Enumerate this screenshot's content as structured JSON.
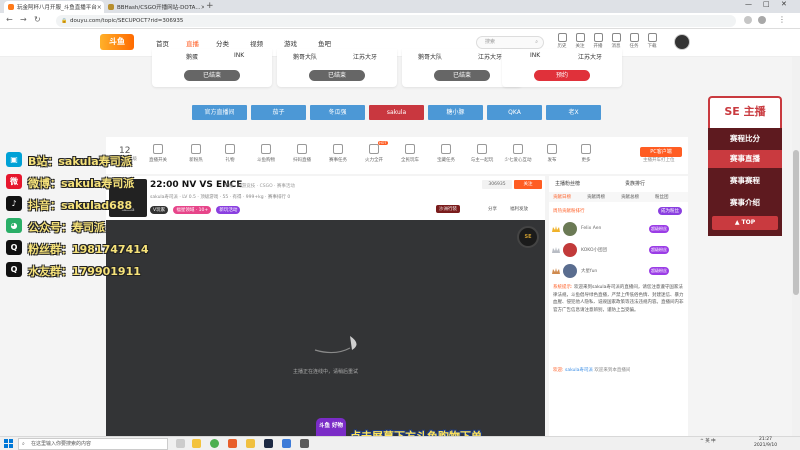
{
  "browser": {
    "tabs": [
      {
        "title": "玩金阿杯八月开服_斗鱼直播平台",
        "active": true
      },
      {
        "title": "BBHash/CSGO开播网站-DOTA...",
        "active": false
      }
    ],
    "new_tab": "+",
    "window_controls": [
      "—",
      "□",
      "✕"
    ],
    "url": "douyu.com/topic/SECUPOCT?rid=306935"
  },
  "site": {
    "logo": "斗鱼",
    "nav": [
      "首页",
      "直播",
      "分类",
      "视频",
      "游戏",
      "鱼吧"
    ],
    "nav_active": "直播",
    "search_placeholder": "搜索",
    "header_icons": [
      "历史",
      "关注",
      "开播",
      "消息",
      "任务",
      "下载"
    ]
  },
  "schedule": [
    {
      "left": "鹅蛋",
      "right": "INK",
      "button": "已结束"
    },
    {
      "left": "鹅哥大队",
      "right": "江苏大牙",
      "button": "已结束"
    },
    {
      "left": "鹅哥大队",
      "right": "江苏大牙",
      "button": "已结束"
    },
    {
      "left": "INK",
      "right": "江苏大牙",
      "button": "预约"
    }
  ],
  "streamer_tabs": [
    "官方直播间",
    "茄子",
    "冬瓜强",
    "sakula",
    "糖小豚",
    "QKA",
    "老X"
  ],
  "streamer_tab_active": "sakula",
  "activity": {
    "fan_count": "12",
    "fan_label": "主播等级",
    "items": [
      "直播开关",
      "新粉热",
      "礼物",
      "斗鱼购物",
      "扫码直播",
      "赛事任务",
      "火力全开",
      "全民玩车",
      "宝藏任务",
      "与主一起玩",
      "少七爱心互动",
      "发布",
      "更多"
    ],
    "pc_button": "PC客户端",
    "pc_sub": "主播开车打上位"
  },
  "room": {
    "anchor_name": "sakula",
    "title": "22:00 NV VS ENCE",
    "category": "单端 · 同游竞技 · CSGO · 赛事活动",
    "meta": "sakula寿司派 · LV 0.5 · 顶级游戏 · 55 · 有得 · 999+kg · 赛事排行 0",
    "tags": [
      "V玩家",
      "福星领域 · 10+",
      "新玩活动"
    ],
    "room_no": "306935",
    "follow": "关注",
    "actions": [
      "分享",
      "福利发放"
    ],
    "report": "沙洲行装",
    "loading_text": "主播正在连线中，请稍后重试"
  },
  "chat": {
    "tabs": [
      "主播粉丝榜",
      "贵族排行"
    ],
    "subtabs": [
      "贡献日榜",
      "贡献周榜",
      "贡献总榜",
      "粉丝团"
    ],
    "week_label": "周热贡献粉排行",
    "week_button": "成为粉丝",
    "ranks": [
      {
        "name": "Felix Aen",
        "badge": "超级粉丝"
      },
      {
        "name": "KOKO小团团",
        "badge": "超级粉丝"
      },
      {
        "name": "大星fun",
        "badge": "超级粉丝"
      }
    ],
    "system_label": "系统提示:",
    "system_msg": "欢迎来到sakula寿司派的直播间，请您注意遵守国家法律法规，斗鱼倡导绿色直播，严禁上传低俗色情、封建迷信、暴力血腥、侵犯他人隐私、诋毁国家政策等违法违规内容。直播间内非官方广告信息请注意辨别，谨防上当受骗。",
    "welcome_label": "欢迎:",
    "welcome_user": "sakula寿司派",
    "welcome_tail": "欢迎来到本直播间"
  },
  "event_panel": {
    "logo": "SE 主播",
    "items": [
      "赛程比分",
      "赛事直播",
      "赛事赛程",
      "赛事介绍"
    ],
    "active": "赛事直播",
    "top": "▲ TOP"
  },
  "overlay": {
    "social": [
      {
        "icon": "tv",
        "text": "B站：sakula寿司派",
        "color": "#00a1d6"
      },
      {
        "icon": "weibo",
        "text": "微博：sakula寿司派",
        "color": "#e6162d"
      },
      {
        "icon": "douyin",
        "text": "抖音：sakulad688",
        "color": "#111111"
      },
      {
        "icon": "wechat",
        "text": "公众号：寿司派",
        "color": "#2aae67"
      },
      {
        "icon": "qq",
        "text": "粉丝群：1981747414",
        "color": "#111111"
      },
      {
        "icon": "qq",
        "text": "水友群：179901911",
        "color": "#111111"
      }
    ],
    "subtitle": "点击屏幕下方斗鱼购物下单",
    "sub_logo": "斗鱼 好物"
  },
  "taskbar": {
    "search_placeholder": "在这里输入你要搜索的内容",
    "time": "21:27",
    "date": "2021/9/10",
    "tray": "^ 英 中"
  },
  "colors": {
    "brand": "#ff5d23",
    "streamer_tab": "#4c98d6",
    "streamer_tab_active": "#c9373f",
    "event_red": "#c93a3f",
    "event_dark": "#5e1a1f"
  }
}
